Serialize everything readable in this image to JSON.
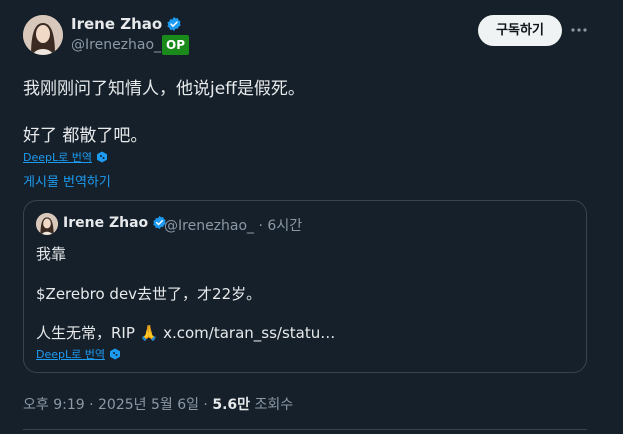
{
  "author": {
    "name": "Irene Zhao",
    "handle": "@Irenezhao_",
    "op_badge": "OP"
  },
  "subscribe_label": "구독하기",
  "post": {
    "line1": "我刚刚问了知情人，他说jeff是假死。",
    "line2": "好了 都散了吧。"
  },
  "translate_deepl": "DeepL로 번역",
  "translate_post": "게시물 번역하기",
  "quote": {
    "name": "Irene Zhao",
    "handle": "@Irenezhao_",
    "separator": "·",
    "time": "6시간",
    "line1": "我靠",
    "line2": "$Zerebro dev去世了，才22岁。",
    "line3_text": "人生无常，RIP 🙏 ",
    "line3_link": "x.com/taran_ss/statu…",
    "translate_deepl": "DeepL로 번역"
  },
  "meta": {
    "datetime": "오후 9:19 · 2025년 5월 6일 · ",
    "views_count": "5.6만",
    "views_label": " 조회수"
  },
  "colors": {
    "background": "#15202b",
    "accent": "#1d9bf0",
    "op_badge": "#1a8a1a"
  }
}
